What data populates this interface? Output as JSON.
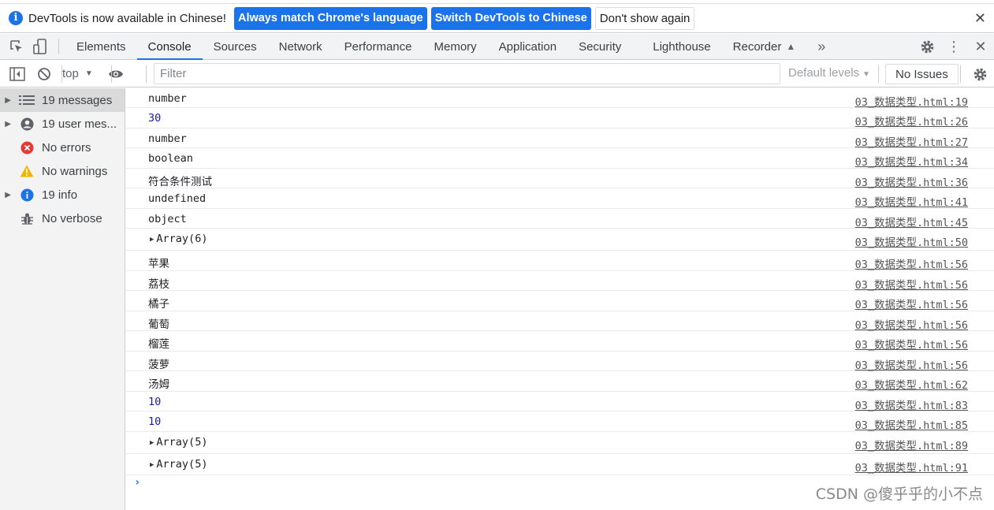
{
  "infobar": {
    "message": "DevTools is now available in Chinese!",
    "btn_match": "Always match Chrome's language",
    "btn_switch": "Switch DevTools to Chinese",
    "btn_dismiss": "Don't show again"
  },
  "tabs": [
    "Elements",
    "Console",
    "Sources",
    "Network",
    "Performance",
    "Memory",
    "Application",
    "Security",
    "Lighthouse",
    "Recorder"
  ],
  "active_tab": "Console",
  "toolbar": {
    "context": "top",
    "filter_placeholder": "Filter",
    "levels": "Default levels",
    "issues": "No Issues"
  },
  "sidebar": [
    {
      "label": "19 messages",
      "icon": "list-icon",
      "expandable": true
    },
    {
      "label": "19 user mes...",
      "icon": "user-icon",
      "expandable": true
    },
    {
      "label": "No errors",
      "icon": "error-icon",
      "expandable": false
    },
    {
      "label": "No warnings",
      "icon": "warning-icon",
      "expandable": false
    },
    {
      "label": "19 info",
      "icon": "info-icon",
      "expandable": true
    },
    {
      "label": "No verbose",
      "icon": "bug-icon",
      "expandable": false
    }
  ],
  "logs": [
    {
      "text": "number",
      "source": "03_数据类型.html:19",
      "kind": "str"
    },
    {
      "text": "30",
      "source": "03_数据类型.html:26",
      "kind": "num"
    },
    {
      "text": "number",
      "source": "03_数据类型.html:27",
      "kind": "str"
    },
    {
      "text": "boolean",
      "source": "03_数据类型.html:34",
      "kind": "str"
    },
    {
      "text": "符合条件测试",
      "source": "03_数据类型.html:36",
      "kind": "str"
    },
    {
      "text": "undefined",
      "source": "03_数据类型.html:41",
      "kind": "str"
    },
    {
      "text": "object",
      "source": "03_数据类型.html:45",
      "kind": "str"
    },
    {
      "text": "Array(6)",
      "source": "03_数据类型.html:50",
      "kind": "obj"
    },
    {
      "text": "苹果",
      "source": "03_数据类型.html:56",
      "kind": "str"
    },
    {
      "text": "荔枝",
      "source": "03_数据类型.html:56",
      "kind": "str"
    },
    {
      "text": "橘子",
      "source": "03_数据类型.html:56",
      "kind": "str"
    },
    {
      "text": "葡萄",
      "source": "03_数据类型.html:56",
      "kind": "str"
    },
    {
      "text": "榴莲",
      "source": "03_数据类型.html:56",
      "kind": "str"
    },
    {
      "text": "菠萝",
      "source": "03_数据类型.html:56",
      "kind": "str"
    },
    {
      "text": "汤姆",
      "source": "03_数据类型.html:62",
      "kind": "str"
    },
    {
      "text": "10",
      "source": "03_数据类型.html:83",
      "kind": "num"
    },
    {
      "text": "10",
      "source": "03_数据类型.html:85",
      "kind": "num"
    },
    {
      "text": "Array(5)",
      "source": "03_数据类型.html:89",
      "kind": "obj"
    },
    {
      "text": "Array(5)",
      "source": "03_数据类型.html:91",
      "kind": "obj"
    }
  ],
  "watermark": "CSDN @傻乎乎的小不点"
}
